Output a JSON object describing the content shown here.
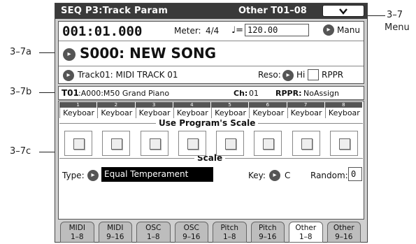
{
  "annotations": {
    "menu": [
      "3–7",
      "Menu"
    ],
    "a": "3–7a",
    "b": "3–7b",
    "c": "3–7c"
  },
  "header": {
    "title": "SEQ  P3:Track Param",
    "page": "Other T01–08",
    "menu_icon": "chevron-down-icon"
  },
  "song": {
    "location": "001:01.000",
    "meter_label": "Meter:",
    "meter": "4/4",
    "tempo_symbol": "♩=",
    "tempo": "120.00",
    "tempo_mode": "Manu",
    "name": "S000: NEW SONG",
    "track": "Track01: MIDI TRACK 01",
    "reso_label": "Reso:",
    "reso": "Hi",
    "rppr_label": "RPPR"
  },
  "track_info": {
    "track": "T01",
    "program": ":A000:M50 Grand Piano",
    "ch_label": "Ch:",
    "ch": "01",
    "rppr_label": "RPPR:",
    "rppr": "NoAssign"
  },
  "columns": {
    "numbers": [
      "1",
      "2",
      "3",
      "4",
      "5",
      "6",
      "7",
      "8"
    ],
    "labels": [
      "Keyboar",
      "Keyboar",
      "Keyboar",
      "Keyboar",
      "Keyboar",
      "Keyboar",
      "Keyboar",
      "Keyboar"
    ]
  },
  "use_program_scale": {
    "title": "Use Program's Scale",
    "checked": [
      false,
      false,
      false,
      false,
      false,
      false,
      false,
      false
    ]
  },
  "scale": {
    "title": "Scale",
    "type_label": "Type:",
    "type": "Equal Temperament",
    "key_label": "Key:",
    "key": "C",
    "random_label": "Random:",
    "random": "0"
  },
  "tabs": [
    {
      "line1": "MIDI",
      "line2": "1–8"
    },
    {
      "line1": "MIDI",
      "line2": "9–16"
    },
    {
      "line1": "OSC",
      "line2": "1–8"
    },
    {
      "line1": "OSC",
      "line2": "9–16"
    },
    {
      "line1": "Pitch",
      "line2": "1–8"
    },
    {
      "line1": "Pitch",
      "line2": "9–16"
    },
    {
      "line1": "Other",
      "line2": "1–8"
    },
    {
      "line1": "Other",
      "line2": "9–16"
    }
  ],
  "active_tab": 6
}
